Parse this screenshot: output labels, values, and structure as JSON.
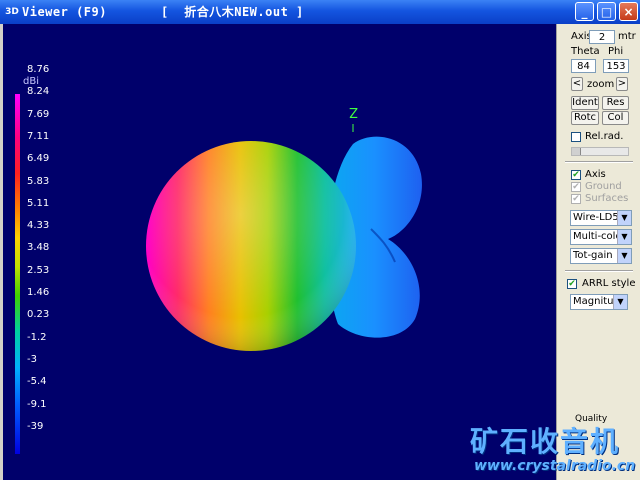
{
  "window": {
    "icon": "3D",
    "title": "Viewer (F9)       [  折合八木NEW.out ]",
    "minimize": "_",
    "maximize": "□",
    "close": "×"
  },
  "viewport": {
    "bg_color": "#00006b",
    "scale_unit": "dBi",
    "scale_ticks": [
      "8.76",
      "8.24",
      "7.69",
      "7.11",
      "6.49",
      "5.83",
      "5.11",
      "4.33",
      "3.48",
      "2.53",
      "1.46",
      "0.23",
      "-1.2",
      "-3",
      "-5.4",
      "-9.1",
      "-39"
    ],
    "axis_label": "Z"
  },
  "panel": {
    "axis_label": "Axis",
    "axis_value": "2",
    "axis_unit": "mtr",
    "theta_label": "Theta",
    "phi_label": "Phi",
    "theta_value": "84",
    "phi_value": "153",
    "zoom_left": "<",
    "zoom_label": "zoom",
    "zoom_right": ">",
    "ident": "Ident",
    "res": "Res",
    "rotc": "Rotc",
    "col": "Col",
    "relrad": "Rel.rad.",
    "axis_check": "Axis",
    "ground_check": "Ground",
    "surfaces_check": "Surfaces",
    "wire_select": "Wire-LD5",
    "color_select": "Multi-colo",
    "gain_select": "Tot-gain",
    "arrl_check": "ARRL style",
    "mag_select": "Magnitud",
    "quality": "Quality"
  },
  "watermark": {
    "text": "矿石收音机",
    "url": "www.crystalradio.cn"
  }
}
